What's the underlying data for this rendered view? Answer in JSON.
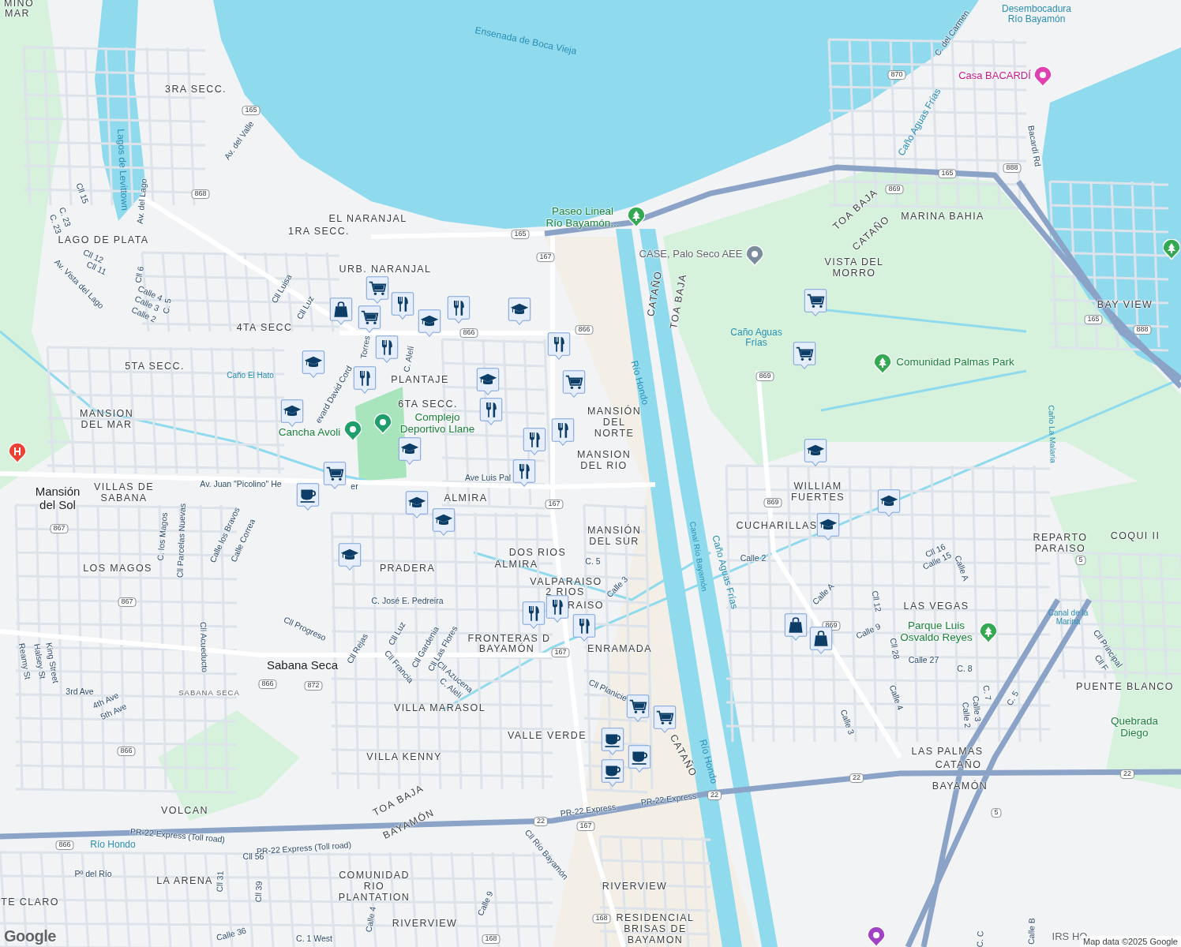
{
  "map": {
    "labels": [
      {
        "kind": "area",
        "text": "MINO"
      },
      {
        "kind": "area",
        "text": "MAR"
      },
      {
        "kind": "area",
        "text": "3RA SECC."
      },
      {
        "kind": "area",
        "text": "EL NARANJAL"
      },
      {
        "kind": "area",
        "text": "1RA SECC."
      },
      {
        "kind": "area",
        "text": "LAGO DE PLATA"
      },
      {
        "kind": "area",
        "text": "URB. NARANJAL"
      },
      {
        "kind": "area",
        "text": "4TA SECC"
      },
      {
        "kind": "area",
        "text": "5TA SECC."
      },
      {
        "kind": "area",
        "text": "PLANTAJE"
      },
      {
        "kind": "area",
        "text": "6TA SECC."
      },
      {
        "kind": "area",
        "text": "MANSION DEL MAR"
      },
      {
        "kind": "area",
        "text": "MANSIÓN DEL NORTE"
      },
      {
        "kind": "area",
        "text": "MANSION DEL RIO"
      },
      {
        "kind": "area",
        "text": "VILLAS DE SABANA"
      },
      {
        "kind": "area",
        "text": "ALMIRA"
      },
      {
        "kind": "area",
        "text": "MANSIÓN DEL SUR"
      },
      {
        "kind": "area",
        "text": "DOS RIOS"
      },
      {
        "kind": "area",
        "text": "ALMIRA"
      },
      {
        "kind": "area",
        "text": "LOS MAGOS"
      },
      {
        "kind": "area",
        "text": "PRADERA"
      },
      {
        "kind": "area",
        "text": "VALPARAISO"
      },
      {
        "kind": "area",
        "text": "2 RIOS"
      },
      {
        "kind": "area",
        "text": "FRONTERAS D"
      },
      {
        "kind": "area",
        "text": "BAYAMÓN"
      },
      {
        "kind": "area",
        "text": "ENRAMADA"
      },
      {
        "kind": "area",
        "text": "VILLA MARASOL"
      },
      {
        "kind": "area",
        "text": "VALLE VERDE"
      },
      {
        "kind": "area",
        "text": "VILLA KENNY"
      },
      {
        "kind": "area",
        "text": "VOLCAN"
      },
      {
        "kind": "area",
        "text": "LA ARENA"
      },
      {
        "kind": "area",
        "text": "COMUNIDAD RIO PLANTATION"
      },
      {
        "kind": "area",
        "text": "RIVERVIEW"
      },
      {
        "kind": "area",
        "text": "RIVERVIEW"
      },
      {
        "kind": "area",
        "text": "RESIDENCIAL BRISAS DE BAYAMON"
      },
      {
        "kind": "area",
        "text": "TE CLARO"
      },
      {
        "kind": "area",
        "text": "MARINA BAHIA"
      },
      {
        "kind": "area",
        "text": "VISTA DEL MORRO"
      },
      {
        "kind": "area",
        "text": "BAY VIEW"
      },
      {
        "kind": "area",
        "text": "TOA BAJA"
      },
      {
        "kind": "area",
        "text": "CATAÑO"
      },
      {
        "kind": "area",
        "text": "WILLIAM FUERTES"
      },
      {
        "kind": "area",
        "text": "CUCHARILLAS"
      },
      {
        "kind": "area",
        "text": "REPARTO PARAISO"
      },
      {
        "kind": "area",
        "text": "COQUI II"
      },
      {
        "kind": "area",
        "text": "LAS VEGAS"
      },
      {
        "kind": "area",
        "text": "PUENTE BLANCO"
      },
      {
        "kind": "area",
        "text": "LAS PALMAS"
      },
      {
        "kind": "area",
        "text": "CATAÑO"
      },
      {
        "kind": "area",
        "text": "BAYAMÓN"
      },
      {
        "kind": "area",
        "text": "CATAÑO"
      },
      {
        "kind": "area",
        "text": "TOA BAJA"
      },
      {
        "kind": "area",
        "text": "CATAÑO"
      },
      {
        "kind": "area",
        "text": "TOA BAJA"
      },
      {
        "kind": "area",
        "text": "BAYAMÓN"
      },
      {
        "kind": "area-small",
        "text": "SABANA SECA"
      },
      {
        "kind": "city",
        "text": "Mansión del Sol"
      },
      {
        "kind": "city",
        "text": "Sabana Seca"
      },
      {
        "kind": "water",
        "text": "Ensenada de Boca Vieja"
      },
      {
        "kind": "water",
        "text": "Lagos de Levittown"
      },
      {
        "kind": "water",
        "text": "Río Hondo"
      },
      {
        "kind": "water-small",
        "text": "Canal Río Bayamón"
      },
      {
        "kind": "water",
        "text": "Caño Aguas Frías"
      },
      {
        "kind": "water",
        "text": "Río Hondo"
      },
      {
        "kind": "water",
        "text": "Caño Aguas Frías"
      },
      {
        "kind": "water-small",
        "text": "Caño La Malaria"
      },
      {
        "kind": "water-small",
        "text": "Canal de la Marina"
      },
      {
        "kind": "water-small",
        "text": "Caño El Hato"
      },
      {
        "kind": "water",
        "text": "Río Hondo"
      },
      {
        "kind": "water",
        "text": "Caño Aguas Frías"
      },
      {
        "kind": "water",
        "text": "Desembocadura Río Bayamón"
      },
      {
        "kind": "brand",
        "text": "Casa BACARDÍ"
      },
      {
        "kind": "park",
        "text": "Paseo Lineal Río Bayamón..."
      },
      {
        "kind": "place",
        "text": "CASE, Palo Seco AEE"
      },
      {
        "kind": "park",
        "text": "Comunidad Palmas Park"
      },
      {
        "kind": "park",
        "text": "Cancha Avoli"
      },
      {
        "kind": "park",
        "text": "Complejo Deportivo Llane"
      },
      {
        "kind": "park",
        "text": "Parque Luis Osvaldo Reyes"
      },
      {
        "kind": "park",
        "text": "Quebrada Diego"
      },
      {
        "kind": "place",
        "text": "IRS HO"
      },
      {
        "kind": "street",
        "text": "Av. del Valle"
      },
      {
        "kind": "street",
        "text": "Av. del Lago"
      },
      {
        "kind": "street",
        "text": "Cll 15"
      },
      {
        "kind": "street",
        "text": "C. 23"
      },
      {
        "kind": "street",
        "text": "C. 23"
      },
      {
        "kind": "street",
        "text": "Cll 12"
      },
      {
        "kind": "street",
        "text": "Cll 11"
      },
      {
        "kind": "street",
        "text": "Av. Vista del Lago"
      },
      {
        "kind": "street",
        "text": "Cll 6"
      },
      {
        "kind": "street",
        "text": "Calle 4"
      },
      {
        "kind": "street",
        "text": "Calle 3"
      },
      {
        "kind": "street",
        "text": "Calle 2"
      },
      {
        "kind": "street",
        "text": "C. 5"
      },
      {
        "kind": "street",
        "text": "Cll Luisa"
      },
      {
        "kind": "street",
        "text": "Cll Luz"
      },
      {
        "kind": "street",
        "text": "C. Alelí"
      },
      {
        "kind": "street",
        "text": "Av. Juan \"Picolino\" He"
      },
      {
        "kind": "street",
        "text": "er"
      },
      {
        "kind": "street",
        "text": "Ave Luis Pal"
      },
      {
        "kind": "street",
        "text": "C. los Magos"
      },
      {
        "kind": "street",
        "text": "Cll Parcelas Nuevas"
      },
      {
        "kind": "street",
        "text": "Calle los Bravos"
      },
      {
        "kind": "street",
        "text": "Calle Correa"
      },
      {
        "kind": "street",
        "text": "C. José E. Pedreira"
      },
      {
        "kind": "street",
        "text": "Cll Progreso"
      },
      {
        "kind": "street",
        "text": "Cll Acueducto"
      },
      {
        "kind": "street",
        "text": "King Street"
      },
      {
        "kind": "street",
        "text": "Halsey St"
      },
      {
        "kind": "street",
        "text": "Reamy St"
      },
      {
        "kind": "street",
        "text": "3rd Ave"
      },
      {
        "kind": "street",
        "text": "4th Ave"
      },
      {
        "kind": "street",
        "text": "5th Ave"
      },
      {
        "kind": "street",
        "text": "Cll Rejas"
      },
      {
        "kind": "street",
        "text": "Cll Luz"
      },
      {
        "kind": "street",
        "text": "Cll Francia"
      },
      {
        "kind": "street",
        "text": "Cll Gardenia"
      },
      {
        "kind": "street",
        "text": "Cll Las Flores"
      },
      {
        "kind": "street",
        "text": "Cll Azucena"
      },
      {
        "kind": "street",
        "text": "C. Alelí"
      },
      {
        "kind": "street",
        "text": "Cll Planicie"
      },
      {
        "kind": "street",
        "text": "C. 5"
      },
      {
        "kind": "street",
        "text": "Calle 3"
      },
      {
        "kind": "street",
        "text": "PR-22 Express (Toll road)"
      },
      {
        "kind": "street",
        "text": "PR-22 Express (Toll road)"
      },
      {
        "kind": "street",
        "text": "PR-22 Express"
      },
      {
        "kind": "street",
        "text": "PR-22 Express"
      },
      {
        "kind": "street",
        "text": "Cll 56"
      },
      {
        "kind": "street",
        "text": "Pº del Río"
      },
      {
        "kind": "street",
        "text": "Cll 31"
      },
      {
        "kind": "street",
        "text": "Cll 39"
      },
      {
        "kind": "street",
        "text": "Calle 4"
      },
      {
        "kind": "street",
        "text": "Calle 36"
      },
      {
        "kind": "street",
        "text": "C. 1 West"
      },
      {
        "kind": "street",
        "text": "Calle 9"
      },
      {
        "kind": "street",
        "text": "Cll Río Bayamón"
      },
      {
        "kind": "street",
        "text": "Calle 2"
      },
      {
        "kind": "street",
        "text": "Calle A"
      },
      {
        "kind": "street",
        "text": "Cll 12"
      },
      {
        "kind": "street",
        "text": "Calle 9"
      },
      {
        "kind": "street",
        "text": "Cll 28"
      },
      {
        "kind": "street",
        "text": "Calle 27"
      },
      {
        "kind": "street",
        "text": "Cll 16"
      },
      {
        "kind": "street",
        "text": "Calle 15"
      },
      {
        "kind": "street",
        "text": "Calle A"
      },
      {
        "kind": "street",
        "text": "C. 8"
      },
      {
        "kind": "street",
        "text": "C. 7"
      },
      {
        "kind": "street",
        "text": "C. 5"
      },
      {
        "kind": "street",
        "text": "Calle 3"
      },
      {
        "kind": "street",
        "text": "Calle 2"
      },
      {
        "kind": "street",
        "text": "Calle 4"
      },
      {
        "kind": "street",
        "text": "Calle 3"
      },
      {
        "kind": "street",
        "text": "Cll Principal"
      },
      {
        "kind": "street",
        "text": "Cll F"
      },
      {
        "kind": "street",
        "text": "Bacardí Rd"
      },
      {
        "kind": "street",
        "text": "C. del Carmen"
      },
      {
        "kind": "street",
        "text": "Calle B"
      },
      {
        "kind": "street",
        "text": "C. C"
      },
      {
        "kind": "street",
        "text": "Torres"
      },
      {
        "kind": "street",
        "text": "evard David Cord"
      },
      {
        "kind": "area",
        "text": "RAISO"
      },
      {
        "kind": "shield",
        "text": "165"
      },
      {
        "kind": "shield",
        "text": "868"
      },
      {
        "kind": "shield",
        "text": "870"
      },
      {
        "kind": "shield",
        "text": "888"
      },
      {
        "kind": "shield",
        "text": "165"
      },
      {
        "kind": "shield",
        "text": "869"
      },
      {
        "kind": "shield",
        "text": "165"
      },
      {
        "kind": "shield",
        "text": "167"
      },
      {
        "kind": "shield",
        "text": "866"
      },
      {
        "kind": "shield",
        "text": "866"
      },
      {
        "kind": "shield",
        "text": "869"
      },
      {
        "kind": "shield",
        "text": "869"
      },
      {
        "kind": "shield",
        "text": "165"
      },
      {
        "kind": "shield",
        "text": "888"
      },
      {
        "kind": "shield",
        "text": "167"
      },
      {
        "kind": "shield",
        "text": "867"
      },
      {
        "kind": "shield",
        "text": "867"
      },
      {
        "kind": "shield",
        "text": "866"
      },
      {
        "kind": "shield",
        "text": "872"
      },
      {
        "kind": "shield",
        "text": "866"
      },
      {
        "kind": "shield",
        "text": "869"
      },
      {
        "kind": "shield",
        "text": "5"
      },
      {
        "kind": "shield",
        "text": "167"
      },
      {
        "kind": "shield",
        "text": "22"
      },
      {
        "kind": "shield",
        "text": "22"
      },
      {
        "kind": "shield",
        "text": "22"
      },
      {
        "kind": "shield",
        "text": "22"
      },
      {
        "kind": "shield",
        "text": "5"
      },
      {
        "kind": "shield",
        "text": "167"
      },
      {
        "kind": "shield",
        "text": "866"
      },
      {
        "kind": "shield",
        "text": "168"
      },
      {
        "kind": "shield",
        "text": "168"
      }
    ],
    "poi_icons": [
      {
        "kind": "tree",
        "color": "#34a853"
      },
      {
        "kind": "tree",
        "color": "#34a853"
      },
      {
        "kind": "tree",
        "color": "#34a853"
      },
      {
        "kind": "tree",
        "color": "#34a853"
      },
      {
        "kind": "dot",
        "color": "#7b8c9c"
      },
      {
        "kind": "dot",
        "color": "#e040b0"
      },
      {
        "kind": "dot",
        "color": "#1e9e6a"
      },
      {
        "kind": "dot",
        "color": "#1e9e6a"
      },
      {
        "kind": "hospital",
        "color": "#ea4335"
      },
      {
        "kind": "dot",
        "color": "#a142c4"
      }
    ],
    "markers": [
      {
        "kind": "cart"
      },
      {
        "kind": "bag"
      },
      {
        "kind": "cart"
      },
      {
        "kind": "restaurant"
      },
      {
        "kind": "restaurant"
      },
      {
        "kind": "school"
      },
      {
        "kind": "restaurant"
      },
      {
        "kind": "school"
      },
      {
        "kind": "restaurant"
      },
      {
        "kind": "school"
      },
      {
        "kind": "restaurant"
      },
      {
        "kind": "school"
      },
      {
        "kind": "school"
      },
      {
        "kind": "restaurant"
      },
      {
        "kind": "restaurant"
      },
      {
        "kind": "cart"
      },
      {
        "kind": "school"
      },
      {
        "kind": "restaurant"
      },
      {
        "kind": "restaurant"
      },
      {
        "kind": "cart"
      },
      {
        "kind": "cafe"
      },
      {
        "kind": "school"
      },
      {
        "kind": "school"
      },
      {
        "kind": "school"
      },
      {
        "kind": "restaurant"
      },
      {
        "kind": "restaurant"
      },
      {
        "kind": "cart"
      },
      {
        "kind": "cart"
      },
      {
        "kind": "cart"
      },
      {
        "kind": "school"
      },
      {
        "kind": "school"
      },
      {
        "kind": "school"
      },
      {
        "kind": "bag"
      },
      {
        "kind": "bag"
      },
      {
        "kind": "cafe"
      },
      {
        "kind": "cafe"
      },
      {
        "kind": "restaurant"
      },
      {
        "kind": "cart"
      },
      {
        "kind": "cafe"
      }
    ]
  },
  "footer": {
    "logo": "Google",
    "attribution": "Map data ©2025 Google"
  }
}
